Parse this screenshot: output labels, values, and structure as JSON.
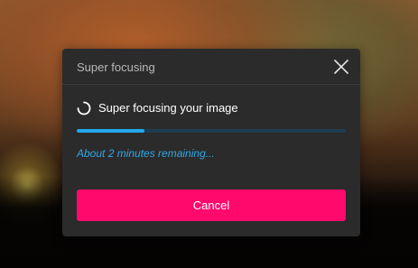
{
  "dialog": {
    "title": "Super focusing",
    "close_icon": "close-icon",
    "status": {
      "icon": "loading-spinner-icon",
      "text": "Super focusing your image"
    },
    "progress": {
      "fraction": 0.25
    },
    "time_remaining": "About 2 minutes remaining...",
    "cancel_label": "Cancel"
  },
  "colors": {
    "accent_button": "#ff0a6c",
    "progress_fill": "#22a9ec",
    "progress_track": "#1f3d52",
    "dialog_background": "#2b2b2b",
    "info_text": "#2fa8e6"
  }
}
